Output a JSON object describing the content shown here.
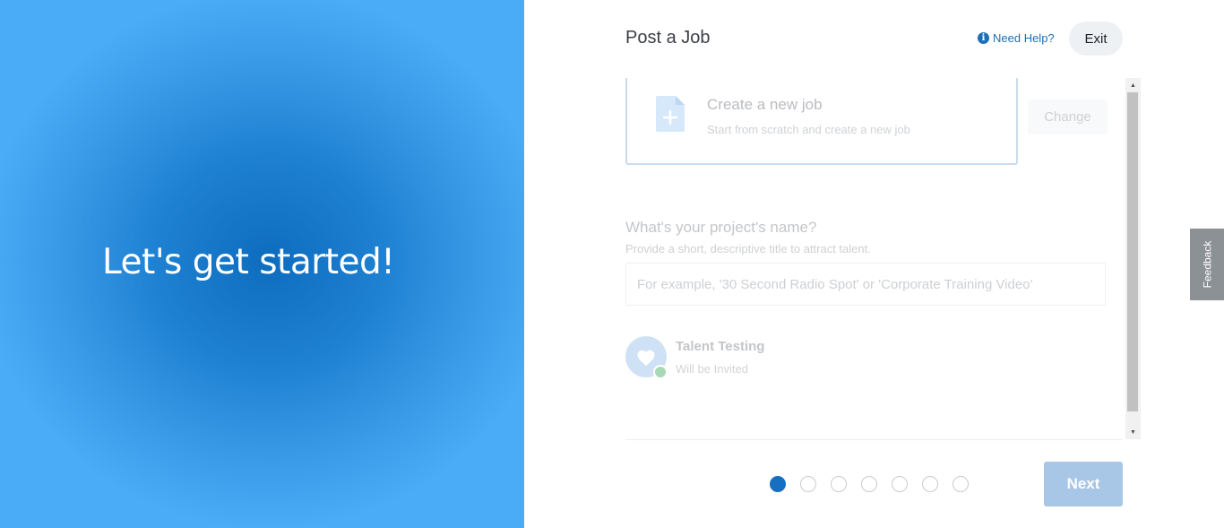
{
  "hero": {
    "title": "Let's get started!"
  },
  "header": {
    "title": "Post a Job",
    "help_label": "Need Help?",
    "exit_label": "Exit"
  },
  "job_type": {
    "title": "Create a new job",
    "subtitle": "Start from scratch and create a new job",
    "change_label": "Change",
    "icon": "document-plus-icon"
  },
  "project_name": {
    "question": "What's your project's name?",
    "hint": "Provide a short, descriptive title to attract talent.",
    "placeholder": "For example, '30 Second Radio Spot' or 'Corporate Training Video'",
    "value": ""
  },
  "talent_testing": {
    "title": "Talent Testing",
    "status": "Will be Invited",
    "icon": "heart-icon"
  },
  "steps": {
    "total": 7,
    "current": 1
  },
  "footer": {
    "next_label": "Next"
  },
  "feedback": {
    "label": "Feedback"
  },
  "colors": {
    "brand_blue": "#176fc1",
    "hero_dark": "#0d6cbe",
    "hero_light": "#4aabf7",
    "next_disabled": "#a8c6e6"
  }
}
